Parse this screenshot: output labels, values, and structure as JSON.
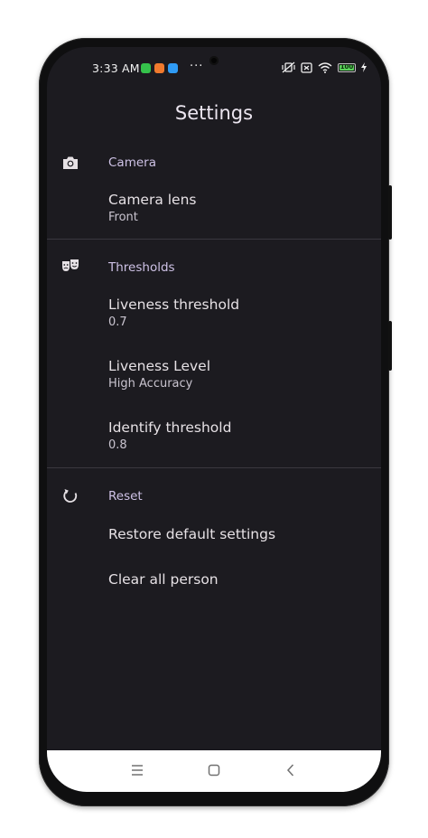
{
  "status_bar": {
    "time": "3:33 AM",
    "more": "···",
    "battery": "100",
    "notification_colors": [
      "#35c24b",
      "#f07a2e",
      "#2f9bf5"
    ]
  },
  "header": {
    "title": "Settings"
  },
  "sections": {
    "camera": {
      "label": "Camera",
      "icon": "camera-icon",
      "items": [
        {
          "title": "Camera lens",
          "summary": "Front"
        }
      ]
    },
    "thresholds": {
      "label": "Thresholds",
      "icon": "theater-masks-icon",
      "items": [
        {
          "title": "Liveness threshold",
          "summary": "0.7"
        },
        {
          "title": "Liveness Level",
          "summary": "High Accuracy"
        },
        {
          "title": "Identify threshold",
          "summary": "0.8"
        }
      ]
    },
    "reset": {
      "label": "Reset",
      "icon": "restore-icon",
      "items": [
        {
          "title": "Restore default settings"
        },
        {
          "title": "Clear all person"
        }
      ]
    }
  },
  "nav_bar": {
    "buttons": [
      "menu-icon",
      "home-icon",
      "back-icon"
    ]
  },
  "colors": {
    "background": "#1c1b20",
    "section_label": "#cec2e6",
    "text_primary": "#e6e1e5",
    "battery": "#5ad35a"
  }
}
